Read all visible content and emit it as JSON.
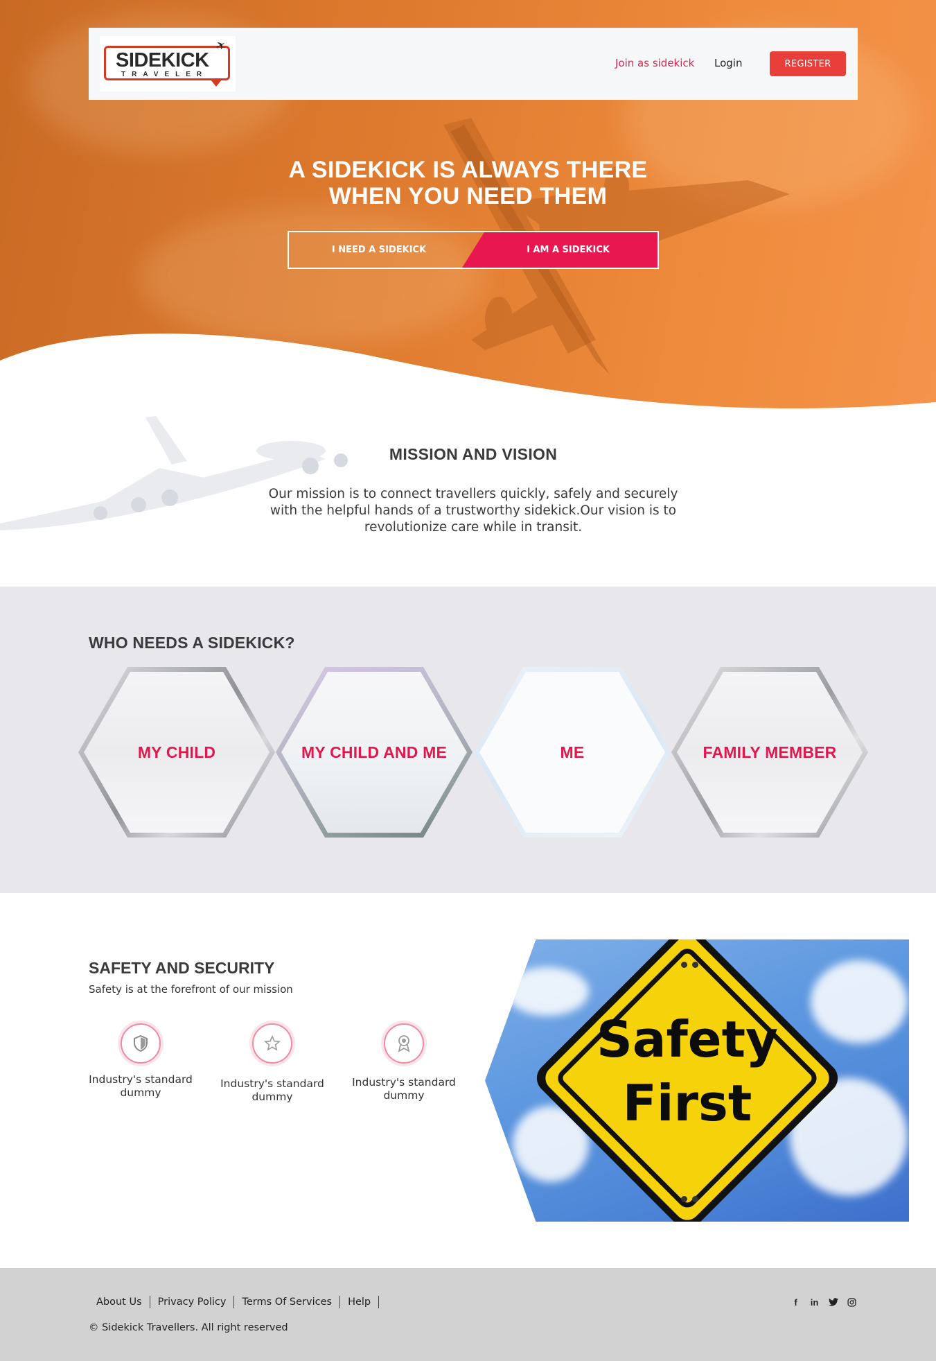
{
  "header": {
    "logo_main": "SIDEKICK",
    "logo_sub": "TRAVELER",
    "join_link": "Join as sidekick",
    "login_link": "Login",
    "register_button": "REGISTER"
  },
  "hero": {
    "title_line1": "A SIDEKICK IS ALWAYS THERE",
    "title_line2": "WHEN YOU NEED THEM",
    "toggle_left": "I NEED A SIDEKICK",
    "toggle_right": "I AM A SIDEKICK"
  },
  "mission": {
    "title": "MISSION AND VISION",
    "line1": "Our mission is to connect travellers quickly, safely and securely",
    "line2": "with the helpful hands of a trustworthy sidekick.Our vision is to",
    "line3": "revolutionize care while in transit."
  },
  "who": {
    "title": "WHO NEEDS A SIDEKICK?",
    "cards": [
      {
        "label": "MY CHILD"
      },
      {
        "label": "MY CHILD AND ME"
      },
      {
        "label": "ME"
      },
      {
        "label": "FAMILY MEMBER"
      }
    ]
  },
  "safety": {
    "title": "SAFETY AND SECURITY",
    "subtitle": "Safety is at the forefront of our mission",
    "features": [
      {
        "icon": "shield-icon",
        "line1": "Industry's standard",
        "line2": "dummy"
      },
      {
        "icon": "star-icon",
        "line1": "Industry's standard",
        "line2": "dummy"
      },
      {
        "icon": "award-icon",
        "line1": "Industry's standard",
        "line2": "dummy"
      }
    ],
    "sign_line1": "Safety",
    "sign_line2": "First"
  },
  "footer": {
    "links": [
      "About Us",
      "Privacy Policy",
      "Terms Of Services",
      "Help"
    ],
    "copyright": "© Sidekick Travellers. All right reserved",
    "socials": [
      "facebook-icon",
      "linkedin-icon",
      "twitter-icon",
      "instagram-icon"
    ]
  },
  "colors": {
    "hero_orange": "#e07c2f",
    "accent_pink": "#e8174f",
    "register_red": "#ea3e3a",
    "section_gray": "#e8e8ec",
    "footer_gray": "#d2d2d2"
  }
}
